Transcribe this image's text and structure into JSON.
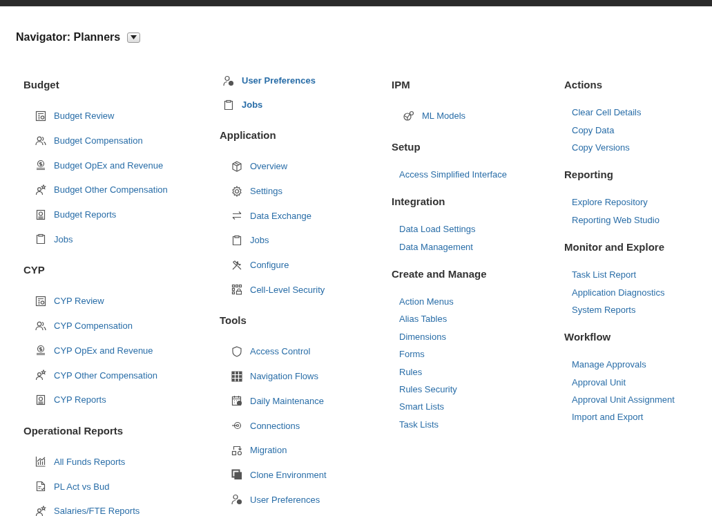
{
  "title": "Navigator: Planners",
  "columns": [
    {
      "sections": [
        {
          "heading": "Budget",
          "items": [
            {
              "label": "Budget Review",
              "kind": "icon-link"
            },
            {
              "label": "Budget Compensation",
              "kind": "icon-link"
            },
            {
              "label": "Budget OpEx and Revenue",
              "kind": "icon-link"
            },
            {
              "label": "Budget Other Compensation",
              "kind": "icon-link"
            },
            {
              "label": "Budget Reports",
              "kind": "icon-link"
            },
            {
              "label": "Jobs",
              "kind": "icon-link"
            }
          ]
        },
        {
          "heading": "CYP",
          "items": [
            {
              "label": "CYP Review",
              "kind": "icon-link"
            },
            {
              "label": "CYP Compensation",
              "kind": "icon-link"
            },
            {
              "label": "CYP OpEx and Revenue",
              "kind": "icon-link"
            },
            {
              "label": "CYP Other Compensation",
              "kind": "icon-link"
            },
            {
              "label": "CYP Reports",
              "kind": "icon-link"
            }
          ]
        },
        {
          "heading": "Operational Reports",
          "items": [
            {
              "label": "All Funds Reports",
              "kind": "icon-link"
            },
            {
              "label": "PL Act vs Bud",
              "kind": "icon-link"
            },
            {
              "label": "Salaries/FTE Reports",
              "kind": "icon-link"
            }
          ]
        }
      ]
    },
    {
      "sections": [
        {
          "items": [
            {
              "label": "User Preferences",
              "kind": "icon-link",
              "bold": true
            },
            {
              "label": "Jobs",
              "kind": "icon-link",
              "bold": true
            }
          ]
        },
        {
          "heading": "Application",
          "items": [
            {
              "label": "Overview",
              "kind": "icon-link"
            },
            {
              "label": "Settings",
              "kind": "icon-link"
            },
            {
              "label": "Data Exchange",
              "kind": "icon-link"
            },
            {
              "label": "Jobs",
              "kind": "icon-link"
            },
            {
              "label": "Configure",
              "kind": "icon-link"
            },
            {
              "label": "Cell-Level Security",
              "kind": "icon-link"
            }
          ]
        },
        {
          "heading": "Tools",
          "items": [
            {
              "label": "Access Control",
              "kind": "icon-link"
            },
            {
              "label": "Navigation Flows",
              "kind": "icon-link"
            },
            {
              "label": "Daily Maintenance",
              "kind": "icon-link"
            },
            {
              "label": "Connections",
              "kind": "icon-link"
            },
            {
              "label": "Migration",
              "kind": "icon-link"
            },
            {
              "label": "Clone Environment",
              "kind": "icon-link"
            },
            {
              "label": "User Preferences",
              "kind": "icon-link"
            }
          ]
        }
      ]
    },
    {
      "sections": [
        {
          "heading": "IPM",
          "items": [
            {
              "label": "ML Models",
              "kind": "icon-link"
            }
          ]
        },
        {
          "heading": "Setup",
          "items": [
            {
              "label": "Access Simplified Interface",
              "kind": "link"
            }
          ]
        },
        {
          "heading": "Integration",
          "items": [
            {
              "label": "Data Load Settings",
              "kind": "link"
            },
            {
              "label": "Data Management",
              "kind": "link"
            }
          ]
        },
        {
          "heading": "Create and Manage",
          "items": [
            {
              "label": "Action Menus",
              "kind": "link"
            },
            {
              "label": "Alias Tables",
              "kind": "link"
            },
            {
              "label": "Dimensions",
              "kind": "link"
            },
            {
              "label": "Forms",
              "kind": "link"
            },
            {
              "label": "Rules",
              "kind": "link"
            },
            {
              "label": "Rules Security",
              "kind": "link"
            },
            {
              "label": "Smart Lists",
              "kind": "link"
            },
            {
              "label": "Task Lists",
              "kind": "link"
            }
          ]
        }
      ]
    },
    {
      "sections": [
        {
          "heading": "Actions",
          "items": [
            {
              "label": "Clear Cell Details",
              "kind": "link"
            },
            {
              "label": "Copy Data",
              "kind": "link"
            },
            {
              "label": "Copy Versions",
              "kind": "link"
            }
          ]
        },
        {
          "heading": "Reporting",
          "items": [
            {
              "label": "Explore Repository",
              "kind": "link"
            },
            {
              "label": "Reporting Web Studio",
              "kind": "link"
            }
          ]
        },
        {
          "heading": "Monitor and Explore",
          "items": [
            {
              "label": "Task List Report",
              "kind": "link"
            },
            {
              "label": "Application Diagnostics",
              "kind": "link"
            },
            {
              "label": "System Reports",
              "kind": "link"
            }
          ]
        },
        {
          "heading": "Workflow",
          "items": [
            {
              "label": "Manage Approvals",
              "kind": "link"
            },
            {
              "label": "Approval Unit",
              "kind": "link"
            },
            {
              "label": "Approval Unit Assignment",
              "kind": "link"
            },
            {
              "label": "Import and Export",
              "kind": "link"
            }
          ]
        }
      ]
    }
  ]
}
